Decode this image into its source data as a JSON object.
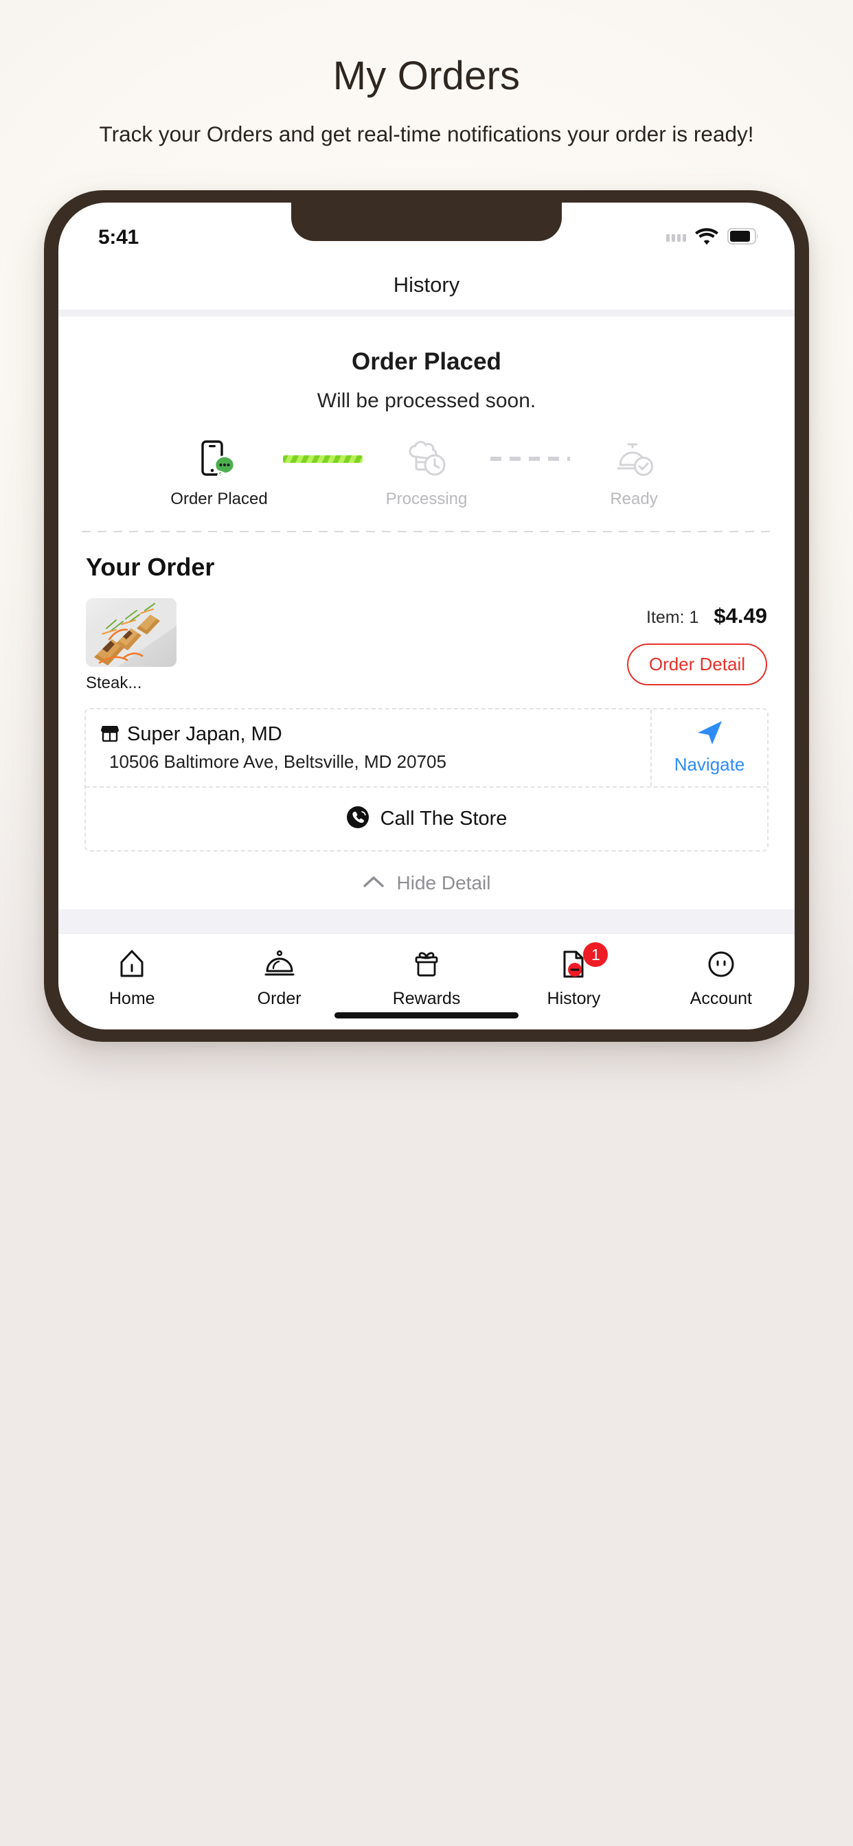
{
  "promo": {
    "title": "My Orders",
    "subtitle": "Track your Orders and get real-time notifications your order is ready!"
  },
  "phone": {
    "status_bar": {
      "time": "5:41",
      "cellular_icon": "cellular-bars-icon",
      "wifi_icon": "wifi-icon",
      "battery_icon": "battery-icon"
    },
    "nav": {
      "title": "History"
    },
    "order_status": {
      "title": "Order Placed",
      "description": "Will be processed soon.",
      "steps": [
        {
          "label": "Order Placed",
          "icon": "phone-chat-icon",
          "state": "active"
        },
        {
          "label": "Processing",
          "icon": "chef-hat-clock-icon",
          "state": "pending"
        },
        {
          "label": "Ready",
          "icon": "bell-check-icon",
          "state": "pending"
        }
      ],
      "connectors": [
        {
          "style": "green-striped"
        },
        {
          "style": "gray-dashed"
        }
      ]
    },
    "your_order": {
      "heading": "Your Order",
      "item": {
        "name": "Steak...",
        "image": "steak-rolls-photo",
        "count_label": "Item: 1",
        "price": "$4.49",
        "detail_button": "Order Detail"
      },
      "store": {
        "icon": "storefront-icon",
        "name": "Super Japan, MD",
        "address": "10506 Baltimore Ave, Beltsville, MD 20705",
        "navigate_label": "Navigate",
        "navigate_icon": "navigation-arrow-icon",
        "call_label": "Call The Store",
        "call_icon": "phone-call-icon"
      },
      "toggle": {
        "label": "Hide Detail",
        "icon": "chevron-up-icon"
      }
    },
    "tabbar": [
      {
        "label": "Home",
        "icon": "home-icon",
        "badge": ""
      },
      {
        "label": "Order",
        "icon": "cloche-icon",
        "badge": ""
      },
      {
        "label": "Rewards",
        "icon": "gift-icon",
        "badge": ""
      },
      {
        "label": "History",
        "icon": "document-icon",
        "badge": "1"
      },
      {
        "label": "Account",
        "icon": "account-face-icon",
        "badge": ""
      }
    ]
  },
  "colors": {
    "frame": "#3a2e24",
    "accent_red": "#e8312a",
    "badge_red": "#ee1c25",
    "link_blue": "#2e8cf6",
    "progress_green": "#7ed321"
  }
}
